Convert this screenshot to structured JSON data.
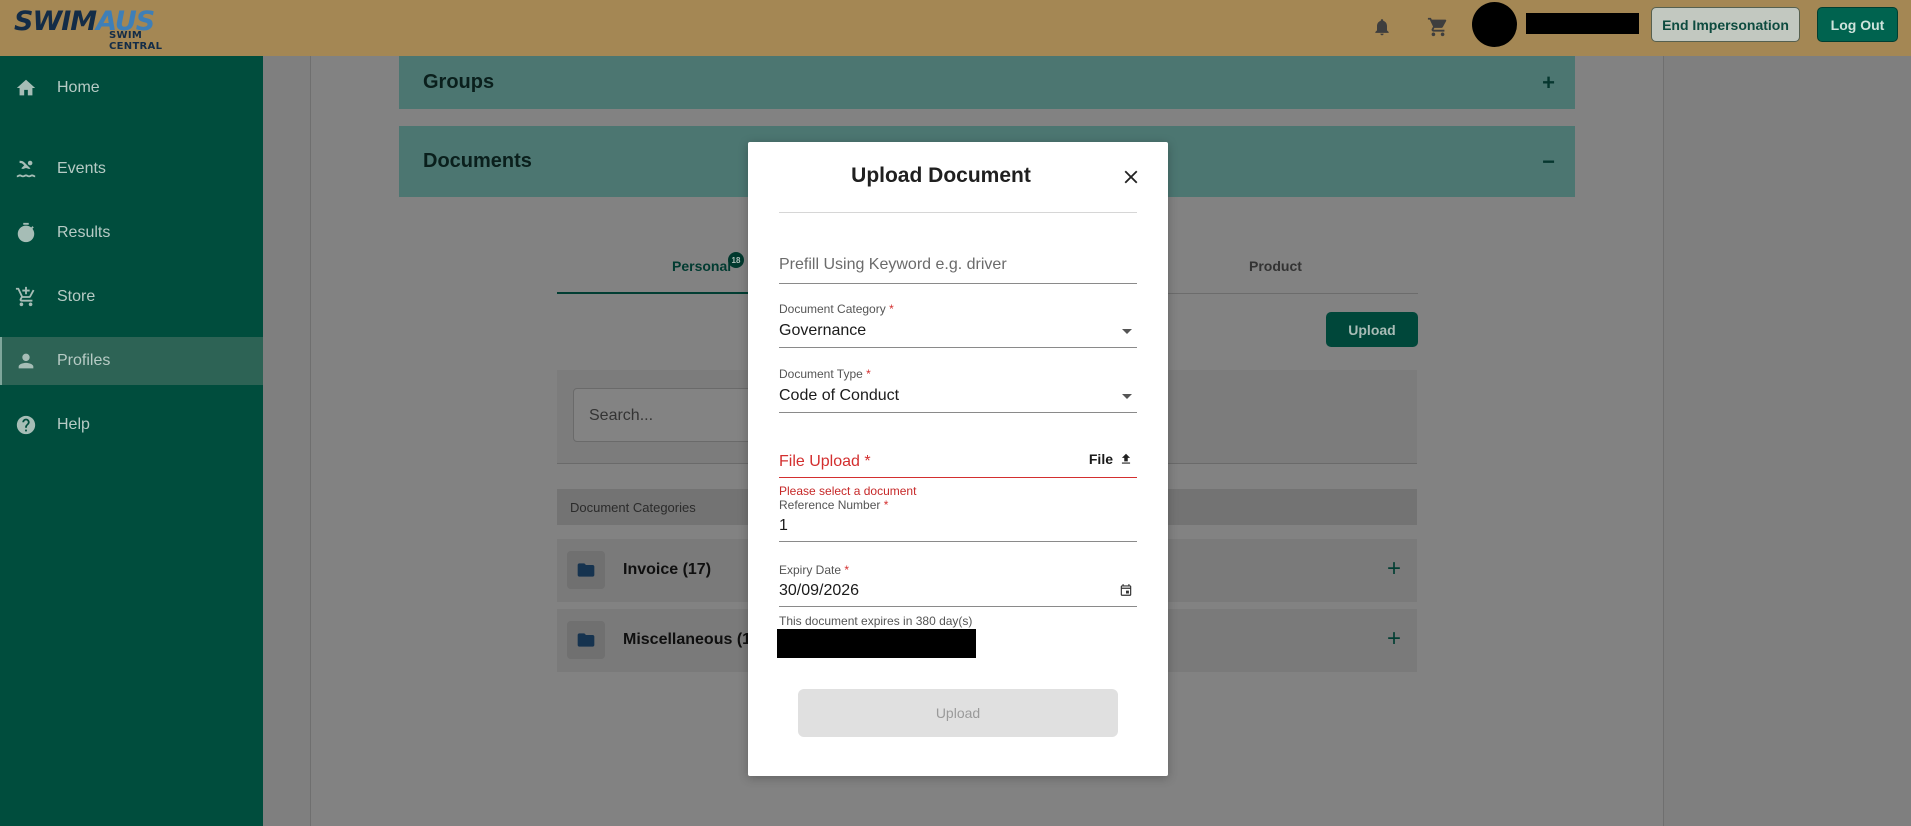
{
  "header": {
    "logo_main_a": "SWIM",
    "logo_main_b": "AUS",
    "logo_sub": "SWIM CENTRAL",
    "end_impersonation": "End Impersonation",
    "log_out": "Log Out",
    "icons": [
      "bell-icon",
      "cart-icon"
    ]
  },
  "sidebar": {
    "items": [
      {
        "label": "Home",
        "icon": "home-icon"
      },
      {
        "label": "Events",
        "icon": "swimmer-icon"
      },
      {
        "label": "Results",
        "icon": "stopwatch-icon"
      },
      {
        "label": "Store",
        "icon": "cart-icon"
      },
      {
        "label": "Profiles",
        "icon": "person-icon",
        "active": true
      },
      {
        "label": "Help",
        "icon": "help-icon"
      }
    ]
  },
  "main": {
    "panels": [
      {
        "title": "Groups",
        "toggle": "+"
      },
      {
        "title": "Documents",
        "toggle": "−"
      }
    ],
    "tabs": [
      {
        "label": "Personal",
        "badge": "18",
        "active": true
      },
      {
        "label": "Product",
        "active": false
      }
    ],
    "upload_label": "Upload",
    "search_placeholder": "Search...",
    "categories_header": "Document Categories",
    "categories": [
      {
        "label": "Invoice (17)"
      },
      {
        "label": "Miscellaneous (1"
      }
    ]
  },
  "modal": {
    "title": "Upload Document",
    "prefill_placeholder": "Prefill Using Keyword e.g. driver",
    "category_label": "Document Category",
    "category_value": "Governance",
    "type_label": "Document Type",
    "type_value": "Code of Conduct",
    "file_label": "File Upload",
    "file_button": "File",
    "file_error": "Please select a document",
    "reference_label": "Reference Number",
    "reference_value": "1",
    "expiry_label": "Expiry Date",
    "expiry_value": "30/09/2026",
    "expiry_hint": "This document expires in 380 day(s)",
    "required_mark": "*",
    "upload_button": "Upload"
  },
  "colors": {
    "topbar": "#a48754",
    "sidebar": "#004d3d",
    "primary": "#00634f",
    "error": "#d32f2f"
  }
}
